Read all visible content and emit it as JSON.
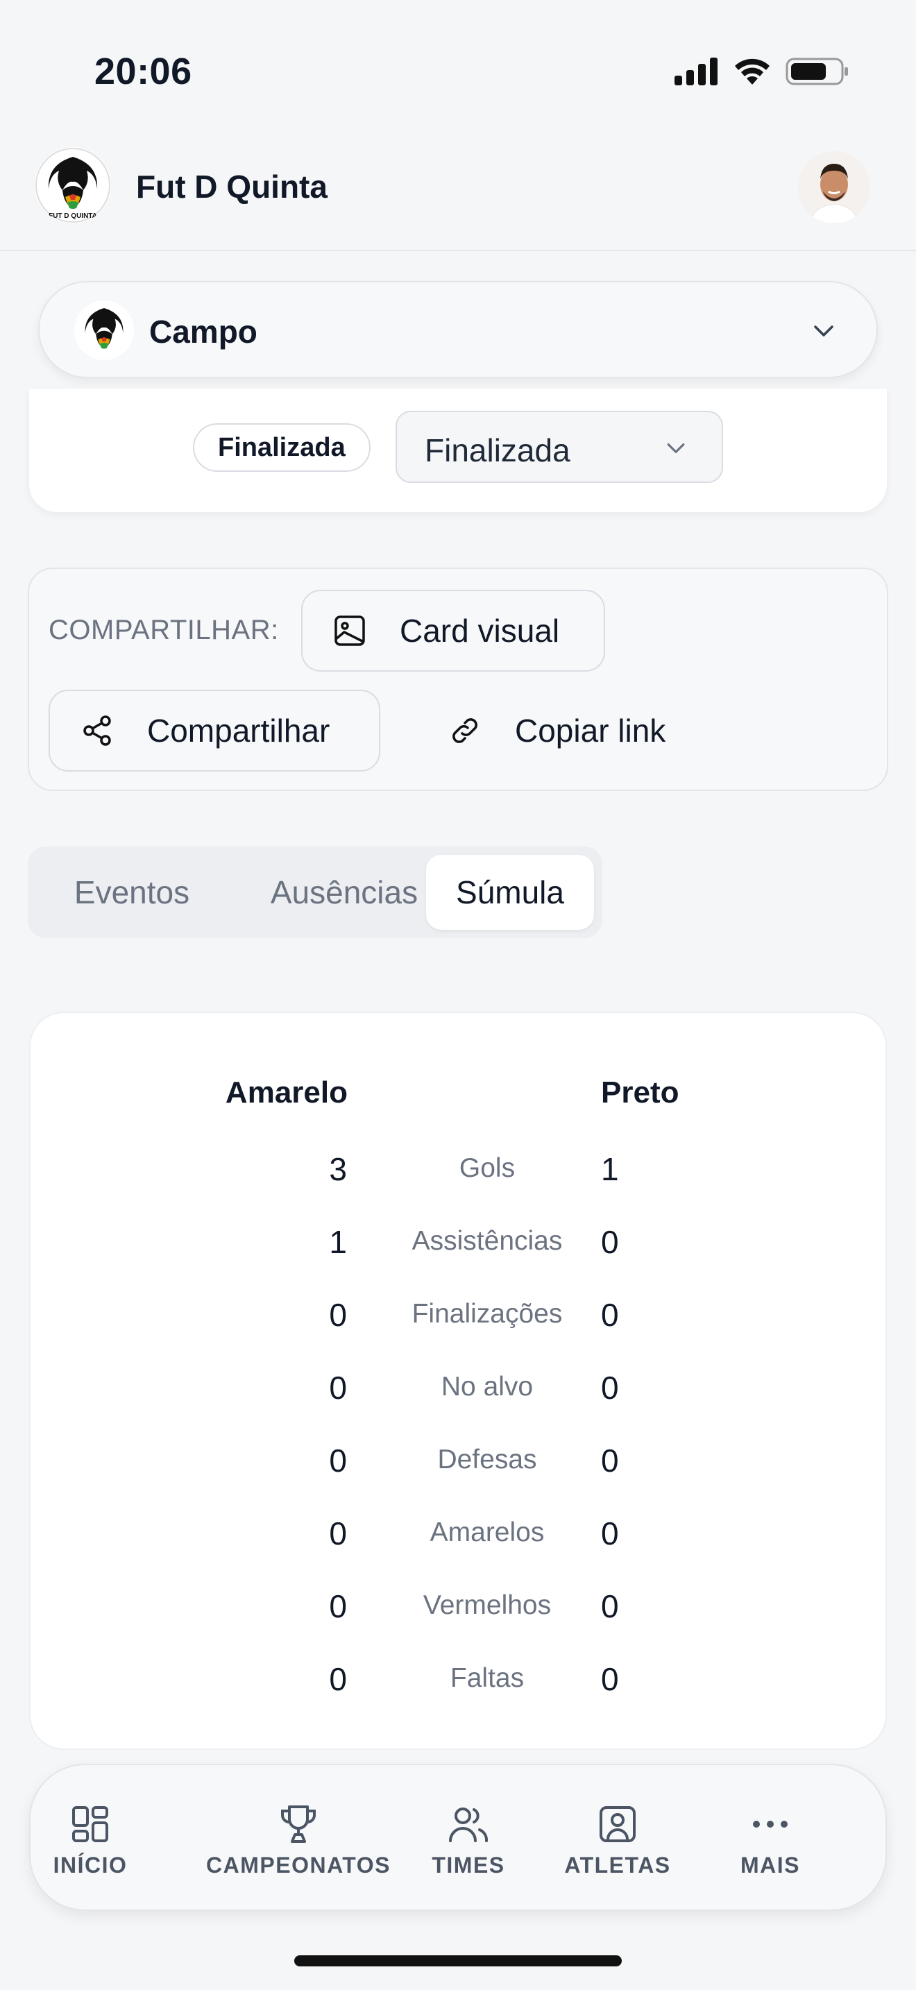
{
  "status_bar": {
    "time": "20:06"
  },
  "header": {
    "title": "Fut D Quinta",
    "logo_text": "FUT D QUINTA"
  },
  "group_select": {
    "label": "Campo"
  },
  "match_status": {
    "badge": "Finalizada",
    "dropdown_value": "Finalizada"
  },
  "share": {
    "label": "COMPARTILHAR:",
    "card_visual": "Card visual",
    "share": "Compartilhar",
    "copy_link": "Copiar link"
  },
  "tabs": [
    {
      "label": "Eventos"
    },
    {
      "label": "Ausências"
    },
    {
      "label": "Súmula",
      "active": true
    }
  ],
  "summary": {
    "team_a": "Amarelo",
    "team_b": "Preto",
    "rows": [
      {
        "label": "Gols",
        "a": "3",
        "b": "1"
      },
      {
        "label": "Assistências",
        "a": "1",
        "b": "0"
      },
      {
        "label": "Finalizações",
        "a": "0",
        "b": "0"
      },
      {
        "label": "No alvo",
        "a": "0",
        "b": "0"
      },
      {
        "label": "Defesas",
        "a": "0",
        "b": "0"
      },
      {
        "label": "Amarelos",
        "a": "0",
        "b": "0"
      },
      {
        "label": "Vermelhos",
        "a": "0",
        "b": "0"
      },
      {
        "label": "Faltas",
        "a": "0",
        "b": "0"
      }
    ]
  },
  "bottom_nav": [
    {
      "label": "INÍCIO",
      "icon": "grid-icon"
    },
    {
      "label": "CAMPEONATOS",
      "icon": "trophy-icon"
    },
    {
      "label": "TIMES",
      "icon": "users-icon"
    },
    {
      "label": "ATLETAS",
      "icon": "athlete-icon"
    },
    {
      "label": "MAIS",
      "icon": "more-icon"
    }
  ]
}
